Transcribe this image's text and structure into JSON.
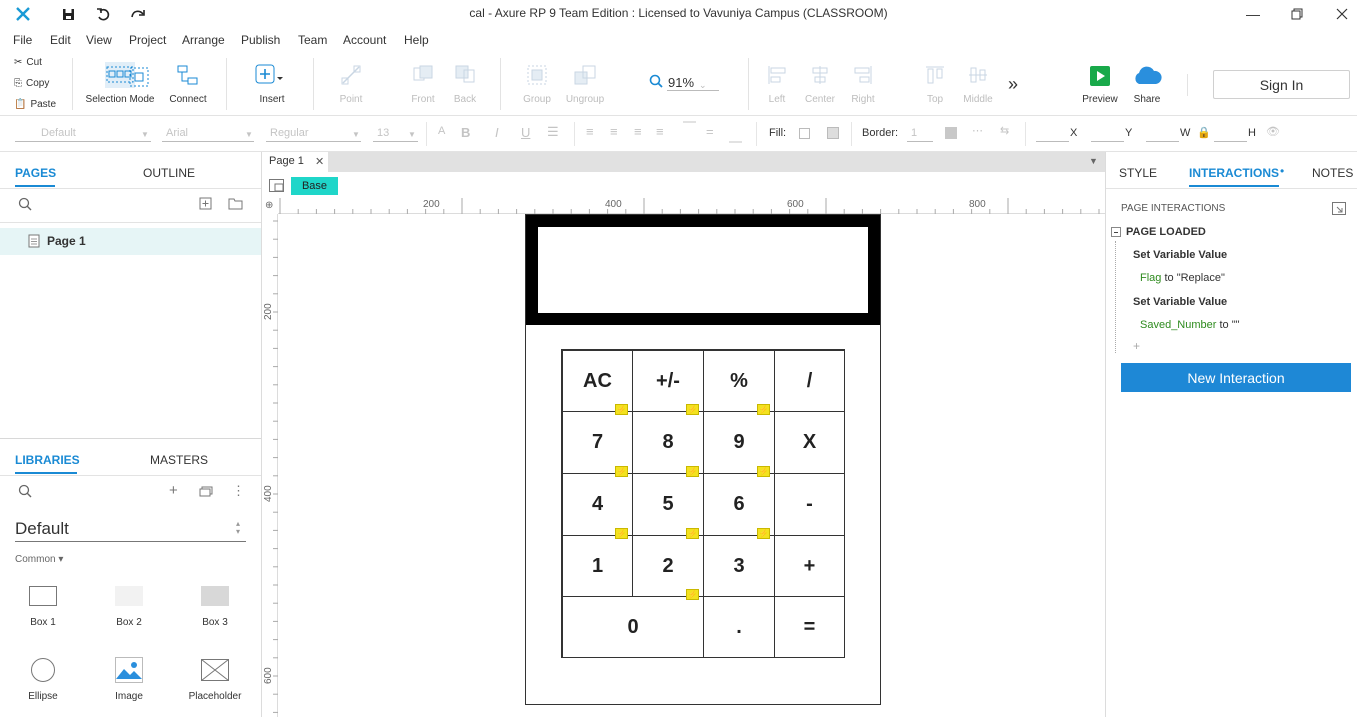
{
  "window": {
    "title": "cal - Axure RP 9 Team Edition : Licensed to Vavuniya Campus (CLASSROOM)"
  },
  "menu": [
    "File",
    "Edit",
    "View",
    "Project",
    "Arrange",
    "Publish",
    "Team",
    "Account",
    "Help"
  ],
  "clipboard": {
    "cut": "Cut",
    "copy": "Copy",
    "paste": "Paste"
  },
  "toolbar": {
    "selection_mode": "Selection Mode",
    "connect": "Connect",
    "insert": "Insert",
    "point": "Point",
    "front": "Front",
    "back": "Back",
    "group": "Group",
    "ungroup": "Ungroup",
    "zoom": "91%",
    "left": "Left",
    "center": "Center",
    "right": "Right",
    "top": "Top",
    "middle": "Middle",
    "more": "»",
    "preview": "Preview",
    "share": "Share",
    "sign_in": "Sign In"
  },
  "format": {
    "style": "Default",
    "font": "Arial",
    "weight": "Regular",
    "size": "13",
    "fill_label": "Fill:",
    "border_label": "Border:",
    "border_value": "1",
    "x_label": "X",
    "y_label": "Y",
    "w_label": "W",
    "h_label": "H"
  },
  "left_top": {
    "tab_pages": "PAGES",
    "tab_outline": "OUTLINE",
    "page_item": "Page 1"
  },
  "left_bottom": {
    "tab_libraries": "LIBRARIES",
    "tab_masters": "MASTERS",
    "library": "Default",
    "category": "Common ▾",
    "widgets": [
      "Box 1",
      "Box 2",
      "Box 3",
      "Ellipse",
      "Image",
      "Placeholder"
    ]
  },
  "canvas": {
    "page_tab": "Page 1",
    "base_label": "Base",
    "ruler_top": [
      "200",
      "400",
      "600",
      "800"
    ],
    "ruler_left": [
      "200",
      "400",
      "600"
    ]
  },
  "calculator": {
    "keys": [
      "AC",
      "+/-",
      "%",
      "/",
      "7",
      "8",
      "9",
      "X",
      "4",
      "5",
      "6",
      "-",
      "1",
      "2",
      "3",
      "+",
      "0",
      ".",
      "="
    ]
  },
  "right": {
    "tab_style": "STYLE",
    "tab_interactions": "INTERACTIONS",
    "tab_notes": "NOTES",
    "section": "PAGE INTERACTIONS",
    "event": "PAGE LOADED",
    "action1": "Set Variable Value",
    "var1": "Flag",
    "to1": " to \"Replace\"",
    "action2": "Set Variable Value",
    "var2": "Saved_Number",
    "to2": " to \"\"",
    "add": "+",
    "new_interaction": "New Interaction"
  },
  "colors": {
    "accent": "#1a8ad4",
    "base_tag": "#1fd6c9",
    "bolt": "#f3e21f"
  }
}
